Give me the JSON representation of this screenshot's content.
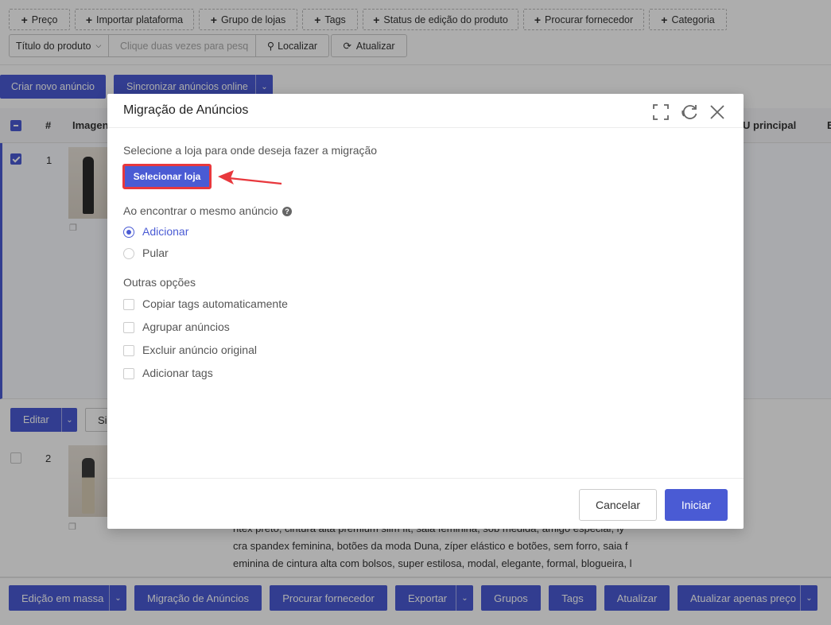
{
  "filters": {
    "chips": [
      "Preço",
      "Importar plataforma",
      "Grupo de lojas",
      "Tags",
      "Status de edição do produto",
      "Procurar fornecedor",
      "Categoria"
    ],
    "select_label": "Título do produto",
    "search_placeholder": "Clique duas vezes para pesq",
    "find_label": "Localizar",
    "refresh_label": "Atualizar"
  },
  "actions": {
    "create_label": "Criar novo anúncio",
    "sync_label": "Sincronizar anúncios online"
  },
  "table": {
    "headers": {
      "num": "#",
      "image": "Imagen",
      "sku": "U principal",
      "extra": "E"
    },
    "row1_num": "1",
    "row2_num": "2",
    "edit_label": "Editar",
    "row_btn_label": "Si",
    "row2_text": [
      "ntex preto, cintura alta premium slim fit, saia feminina, sob medida, amigo especial, ly",
      "cra spandex feminina, botões da moda Duna, zíper elástico e botões, sem forro, saia f",
      "eminina de cintura alta com bolsos, super estilosa, modal, elegante, formal, blogueira, l"
    ]
  },
  "bottom": {
    "buttons": [
      "Edição em massa",
      "Migração de Anúncios",
      "Procurar fornecedor",
      "Exportar",
      "Grupos",
      "Tags",
      "Atualizar",
      "Atualizar apenas preço"
    ]
  },
  "modal": {
    "title": "Migração de Anúncios",
    "select_store_prompt": "Selecione a loja para onde deseja fazer a migração",
    "select_store_button": "Selecionar loja",
    "same_listing_label": "Ao encontrar o mesmo anúncio",
    "radio_add": "Adicionar",
    "radio_skip": "Pular",
    "other_options_label": "Outras opções",
    "options": [
      "Copiar tags automaticamente",
      "Agrupar anúncios",
      "Excluir anúncio original",
      "Adicionar tags"
    ],
    "cancel_label": "Cancelar",
    "start_label": "Iniciar"
  },
  "colors": {
    "accent": "#4a5bd4",
    "highlight": "#e8383d"
  }
}
